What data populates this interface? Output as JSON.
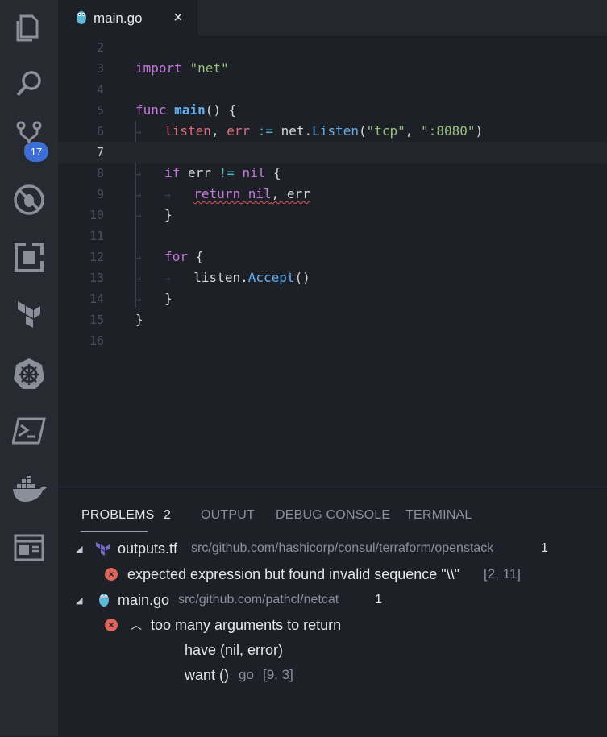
{
  "activity_bar": {
    "items": [
      {
        "name": "explorer-icon"
      },
      {
        "name": "search-icon"
      },
      {
        "name": "source-control-icon",
        "badge": "17"
      },
      {
        "name": "debug-icon"
      },
      {
        "name": "extensions-icon"
      },
      {
        "name": "terraform-icon"
      },
      {
        "name": "kubernetes-icon"
      },
      {
        "name": "powershell-icon"
      },
      {
        "name": "docker-icon"
      },
      {
        "name": "browser-preview-icon"
      }
    ]
  },
  "tabs": [
    {
      "label": "main.go",
      "close": "×",
      "icon": "go-gopher-icon",
      "active": true
    }
  ],
  "editor": {
    "lines": [
      {
        "n": "2"
      },
      {
        "n": "3"
      },
      {
        "n": "4"
      },
      {
        "n": "5"
      },
      {
        "n": "6"
      },
      {
        "n": "7"
      },
      {
        "n": "8"
      },
      {
        "n": "9"
      },
      {
        "n": "10"
      },
      {
        "n": "11"
      },
      {
        "n": "12"
      },
      {
        "n": "13"
      },
      {
        "n": "14"
      },
      {
        "n": "15"
      },
      {
        "n": "16"
      }
    ],
    "code": {
      "l3": {
        "kw": "import",
        "str": "\"net\""
      },
      "l5": {
        "kw": "func",
        "fn": "main",
        "rest": "() {"
      },
      "l6": {
        "v1": "listen",
        "sep": ", ",
        "v2": "err",
        "op": " := ",
        "pkg": "net.",
        "fn": "Listen",
        "p1": "(",
        "s1": "\"tcp\"",
        "c": ", ",
        "s2": "\":8080\"",
        "p2": ")"
      },
      "l8": {
        "kw": "if",
        "rest1": " err ",
        "op": "!=",
        "kw2": " nil",
        "rest2": " {"
      },
      "l9": {
        "kw": "return",
        "kw2": " nil",
        "rest": ", err"
      },
      "l10": {
        "rest": "}"
      },
      "l12": {
        "kw": "for",
        "rest": " {"
      },
      "l13": {
        "obj": "listen.",
        "fn": "Accept",
        "rest": "()"
      },
      "l14": {
        "rest": "}"
      },
      "l15": {
        "rest": "}"
      }
    }
  },
  "panel": {
    "tabs": [
      {
        "label": "PROBLEMS"
      },
      {
        "label": "OUTPUT"
      },
      {
        "label": "DEBUG CONSOLE"
      },
      {
        "label": "TERMINAL"
      }
    ],
    "problem_count": "2",
    "groups": [
      {
        "file": "outputs.tf",
        "path": "src/github.com/hashicorp/consul/terraform/openstack",
        "count": "1",
        "message": "expected expression but found invalid sequence \"\\\\\"",
        "location": "[2, 11]"
      },
      {
        "file": "main.go",
        "path": "src/github.com/pathcl/netcat",
        "count": "1",
        "message": "too many arguments to return",
        "detail1": "have (nil, error)",
        "detail2": "want ()",
        "source": "go",
        "location": "[9, 3]"
      }
    ]
  },
  "colors": {
    "background": "#1e2027",
    "activity_bar": "#282a31",
    "badge": "#3b6fd6",
    "error": "#e0655a",
    "keyword": "#c678dd",
    "string": "#98c379",
    "variable": "#e06c75",
    "function": "#61afef"
  }
}
